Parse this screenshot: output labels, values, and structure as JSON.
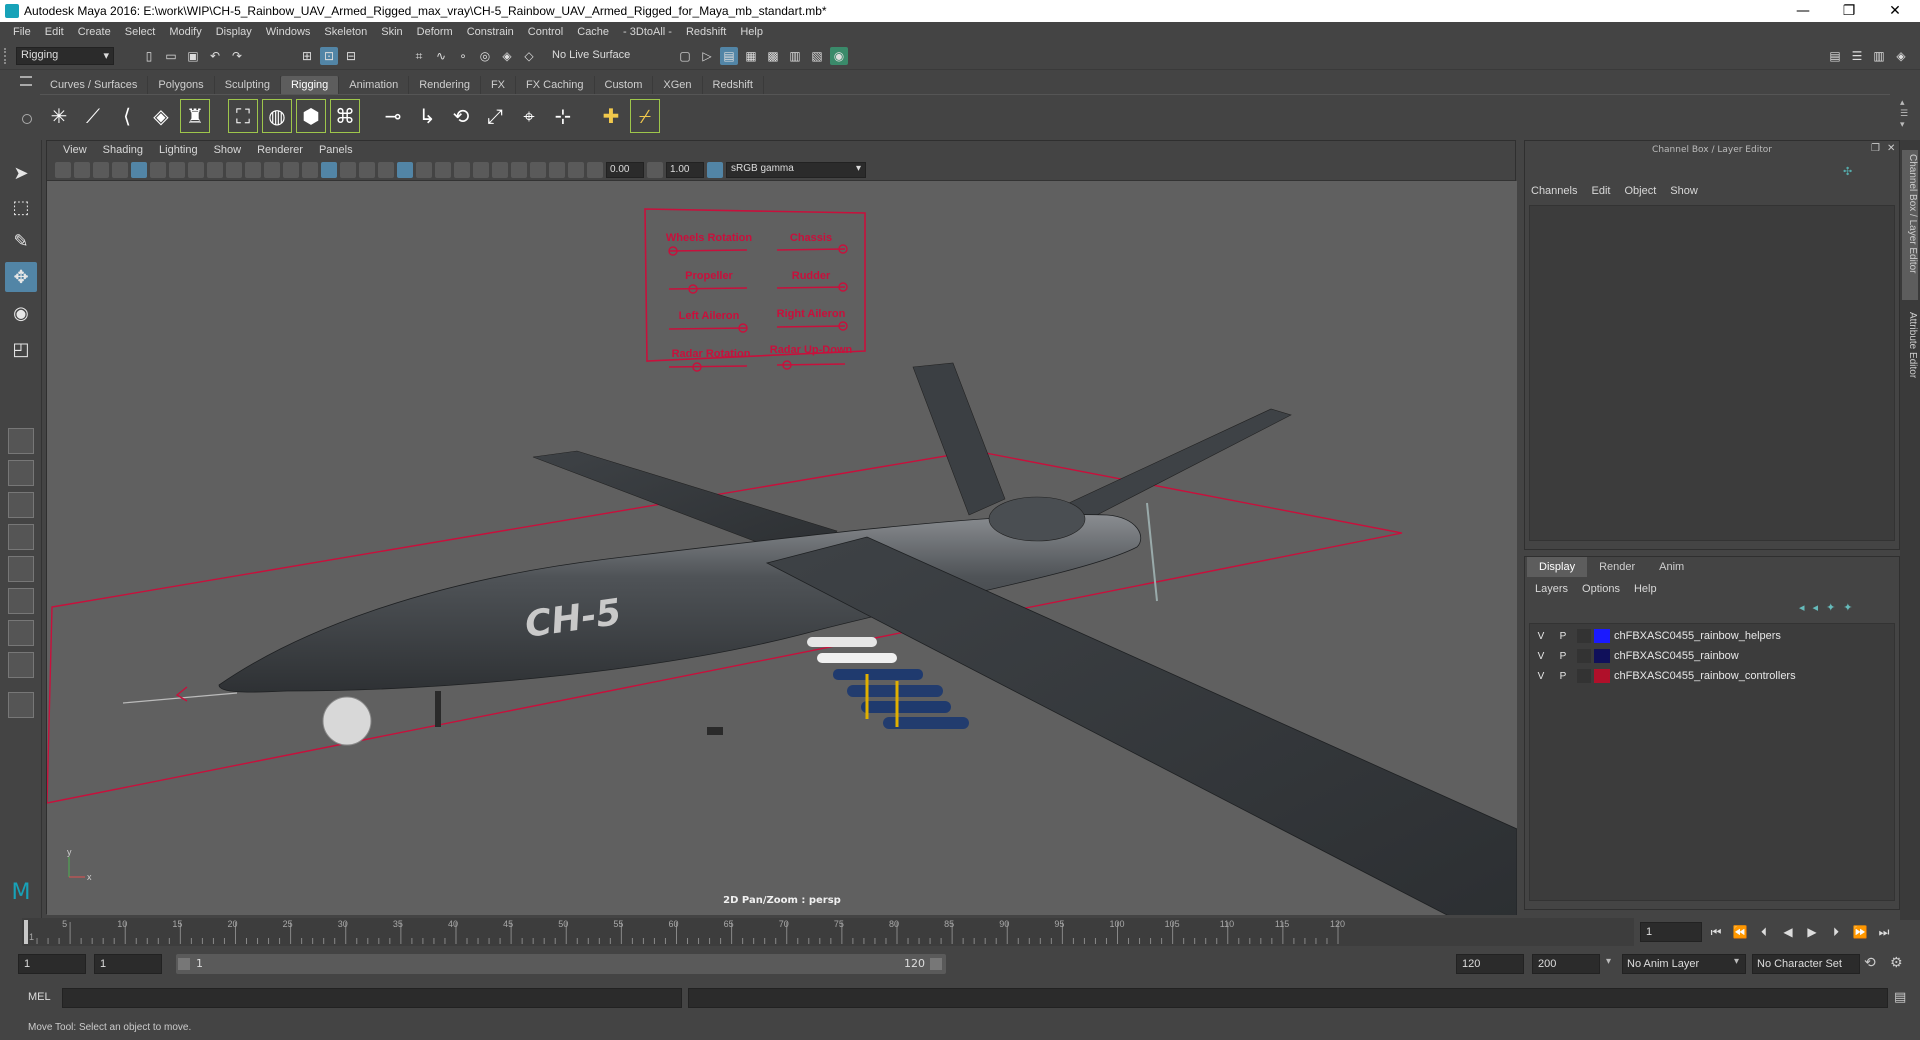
{
  "window": {
    "title": "Autodesk Maya 2016: E:\\work\\WIP\\CH-5_Rainbow_UAV_Armed_Rigged_max_vray\\CH-5_Rainbow_UAV_Armed_Rigged_for_Maya_mb_standart.mb*",
    "minimize": "—",
    "restore": "❐",
    "close": "✕"
  },
  "menubar": [
    "File",
    "Edit",
    "Create",
    "Select",
    "Modify",
    "Display",
    "Windows",
    "Skeleton",
    "Skin",
    "Deform",
    "Constrain",
    "Control",
    "Cache",
    "- 3DtoAll -",
    "Redshift",
    "Help"
  ],
  "statusline": {
    "mode": "Rigging",
    "live_surface": "No Live Surface"
  },
  "shelf_tabs": [
    "Curves / Surfaces",
    "Polygons",
    "Sculpting",
    "Rigging",
    "Animation",
    "Rendering",
    "FX",
    "FX Caching",
    "Custom",
    "XGen",
    "Redshift"
  ],
  "shelf_active": "Rigging",
  "viewport": {
    "menu": [
      "View",
      "Shading",
      "Lighting",
      "Show",
      "Renderer",
      "Panels"
    ],
    "field_a": "0.00",
    "field_b": "1.00",
    "color_space": "sRGB gamma",
    "camera_label": "2D Pan/Zoom : persp",
    "aircraft_marking": "CH-5",
    "axis_x": "x",
    "axis_y": "y",
    "controls": {
      "wheels_rotation": "Wheels Rotation",
      "chassis": "Chassis",
      "propeller": "Propeller",
      "rudder": "Rudder",
      "left_aileron": "Left Aileron",
      "right_aileron": "Right Aileron",
      "radar_rotation": "Radar Rotation",
      "radar_up_down": "Radar Up-Down"
    }
  },
  "channel_box": {
    "title": "Channel Box / Layer Editor",
    "menu": [
      "Channels",
      "Edit",
      "Object",
      "Show"
    ]
  },
  "layer_editor": {
    "tabs": [
      "Display",
      "Render",
      "Anim"
    ],
    "active_tab": "Display",
    "menu": [
      "Layers",
      "Options",
      "Help"
    ],
    "layers": [
      {
        "v": "V",
        "p": "P",
        "name": "chFBXASC0455_rainbow_helpers",
        "color": "#1a1aff"
      },
      {
        "v": "V",
        "p": "P",
        "name": "chFBXASC0455_rainbow",
        "color": "#10105a"
      },
      {
        "v": "V",
        "p": "P",
        "name": "chFBXASC0455_rainbow_controllers",
        "color": "#b0102a"
      }
    ]
  },
  "side_tabs": [
    "Channel Box / Layer Editor",
    "Attribute Editor"
  ],
  "timeline": {
    "ticks": [
      "5",
      "10",
      "15",
      "20",
      "25",
      "30",
      "35",
      "40",
      "45",
      "50",
      "55",
      "60",
      "65",
      "70",
      "75",
      "80",
      "85",
      "90",
      "95",
      "100",
      "105",
      "110",
      "115",
      "120"
    ],
    "start_tick": "1",
    "current_frame": "1"
  },
  "range": {
    "start": "1",
    "playback_start": "1",
    "bar_start": "1",
    "bar_end": "120",
    "playback_end": "120",
    "end": "200",
    "anim_layer": "No Anim Layer",
    "character_set": "No Character Set"
  },
  "command_line": {
    "label": "MEL"
  },
  "help_line": {
    "text": "Move Tool: Select an object to move."
  },
  "colors": {
    "accent": "#5285a6",
    "rig_red": "#c8103c"
  }
}
